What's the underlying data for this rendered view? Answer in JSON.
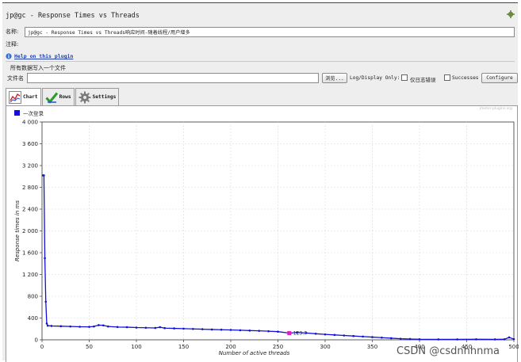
{
  "window": {
    "title": "jp@gc - Response Times vs Threads"
  },
  "form": {
    "name_label": "名称:",
    "name_value": "jp@gc - Response Times vs Threads响应时间-随着线程/用户增多",
    "comment_label": "注释:",
    "help_link": "Help on this plugin",
    "write_all_label": "所有数据写入一个文件",
    "file_label": "文件名",
    "file_value": "",
    "browse_button": "浏览...",
    "log_display_label": "Log/Display Only:",
    "errors_label": "仅日志错误",
    "errors_checked": false,
    "successes_label": "Successes",
    "successes_checked": false,
    "configure_button": "Configure"
  },
  "tabs": [
    {
      "label": "Chart",
      "icon": "chart-icon",
      "active": true
    },
    {
      "label": "Rows",
      "icon": "checkmark-icon",
      "active": false
    },
    {
      "label": "Settings",
      "icon": "gear-icon",
      "active": false
    }
  ],
  "colors": {
    "series": "#1010d8",
    "marker": "#e020c0",
    "grid": "#d9d9d9"
  },
  "watermark": "CSDN @csdnhhnma",
  "chart_data": {
    "type": "line",
    "legend_placement": "top-left",
    "credit": "jmeter-plugins.org",
    "ylabel": "Response times in ms",
    "xlabel": "Number of active threads",
    "xlim": [
      0,
      500
    ],
    "ylim": [
      0,
      4000
    ],
    "x_ticks": [
      "0",
      "50",
      "100",
      "150",
      "200",
      "250",
      "300",
      "350",
      "400",
      "450",
      "500"
    ],
    "y_ticks": [
      "0",
      "400",
      "800",
      "1 200",
      "1 600",
      "2 000",
      "2 400",
      "2 800",
      "3 200",
      "3 600",
      "4 000"
    ],
    "grid": true,
    "highlight": {
      "x": 262,
      "y": 123,
      "label": "123.7"
    },
    "series": [
      {
        "name": "一次登录",
        "points": [
          [
            1,
            3020
          ],
          [
            2,
            3020
          ],
          [
            3,
            1500
          ],
          [
            4,
            700
          ],
          [
            5,
            300
          ],
          [
            6,
            260
          ],
          [
            10,
            255
          ],
          [
            20,
            250
          ],
          [
            30,
            245
          ],
          [
            40,
            240
          ],
          [
            50,
            238
          ],
          [
            55,
            245
          ],
          [
            60,
            270
          ],
          [
            65,
            265
          ],
          [
            70,
            245
          ],
          [
            80,
            235
          ],
          [
            90,
            232
          ],
          [
            100,
            225
          ],
          [
            110,
            222
          ],
          [
            120,
            218
          ],
          [
            125,
            232
          ],
          [
            130,
            215
          ],
          [
            140,
            210
          ],
          [
            150,
            205
          ],
          [
            160,
            200
          ],
          [
            170,
            195
          ],
          [
            180,
            190
          ],
          [
            190,
            186
          ],
          [
            200,
            182
          ],
          [
            210,
            176
          ],
          [
            220,
            170
          ],
          [
            230,
            165
          ],
          [
            240,
            158
          ],
          [
            250,
            150
          ],
          [
            262,
            124
          ],
          [
            270,
            135
          ],
          [
            280,
            125
          ],
          [
            290,
            112
          ],
          [
            300,
            100
          ],
          [
            310,
            90
          ],
          [
            320,
            80
          ],
          [
            330,
            70
          ],
          [
            340,
            60
          ],
          [
            350,
            50
          ],
          [
            360,
            40
          ],
          [
            370,
            30
          ],
          [
            380,
            20
          ],
          [
            390,
            15
          ],
          [
            400,
            10
          ],
          [
            420,
            8
          ],
          [
            440,
            8
          ],
          [
            460,
            10
          ],
          [
            480,
            8
          ],
          [
            490,
            10
          ],
          [
            495,
            45
          ],
          [
            500,
            12
          ]
        ]
      }
    ]
  }
}
